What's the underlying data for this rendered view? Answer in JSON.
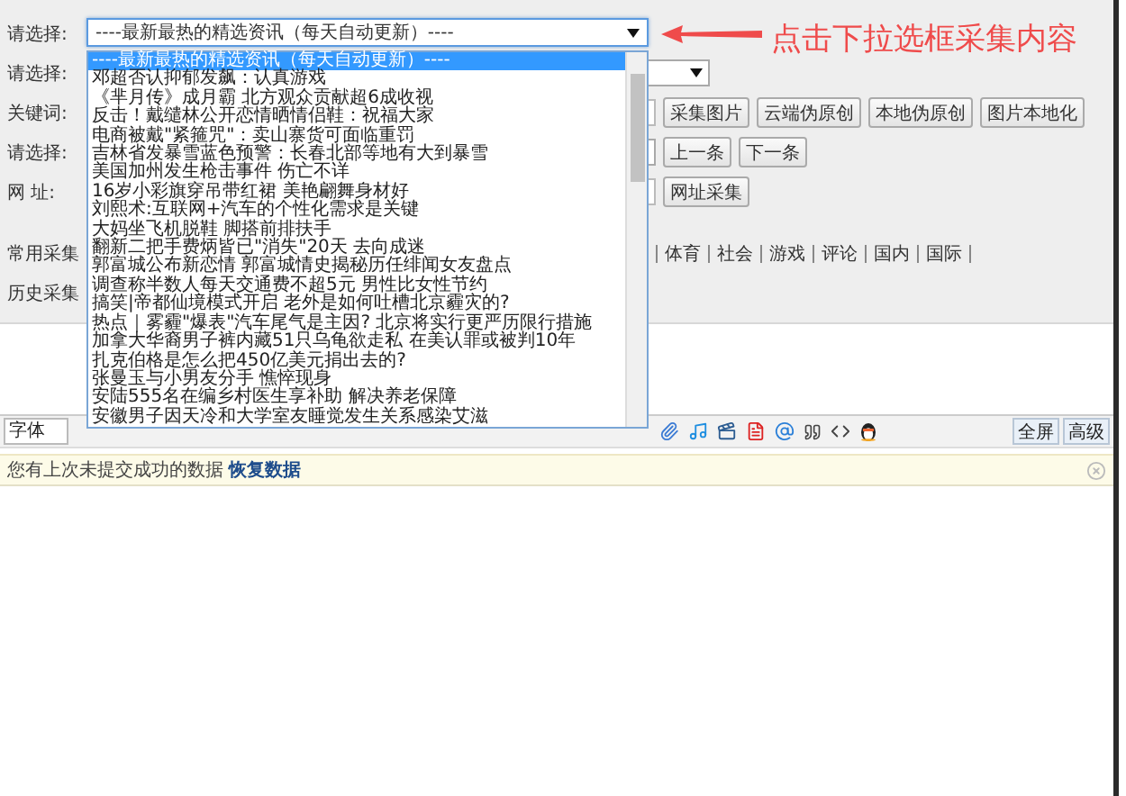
{
  "dropdown": {
    "value": "----最新最热的精选资讯（每天自动更新）----",
    "expanded": true,
    "options": [
      {
        "text": "----最新最热的精选资讯（每天自动更新）----",
        "selected": true
      },
      {
        "text": "邓超否认抑郁发飙：认真游戏",
        "selected": false
      },
      {
        "text": "《芈月传》成月霸 北方观众贡献超6成收视",
        "selected": false
      },
      {
        "text": "反击！戴缱林公开恋情晒情侣鞋：祝福大家",
        "selected": false
      },
      {
        "text": "电商被戴\"紧箍咒\"：卖山寨货可面临重罚",
        "selected": false
      },
      {
        "text": "吉林省发暴雪蓝色预警：长春北部等地有大到暴雪",
        "selected": false
      },
      {
        "text": "美国加州发生枪击事件 伤亡不详",
        "selected": false
      },
      {
        "text": "16岁小彩旗穿吊带红裙 美艳翩舞身材好",
        "selected": false
      },
      {
        "text": "刘熙术:互联网+汽车的个性化需求是关键",
        "selected": false
      },
      {
        "text": "大妈坐飞机脱鞋 脚搭前排扶手",
        "selected": false
      },
      {
        "text": "翻新二把手费炳皆已\"消失\"20天 去向成迷",
        "selected": false
      },
      {
        "text": "郭富城公布新恋情 郭富城情史揭秘历任绯闻女友盘点",
        "selected": false
      },
      {
        "text": "调查称半数人每天交通费不超5元 男性比女性节约",
        "selected": false
      },
      {
        "text": "搞笑|帝都仙境模式开启 老外是如何吐槽北京霾灾的?",
        "selected": false
      },
      {
        "text": "热点｜雾霾\"爆表\"汽车尾气是主因? 北京将实行更严历限行措施",
        "selected": false
      },
      {
        "text": "加拿大华裔男子裤内藏51只乌龟欲走私 在美认罪或被判10年",
        "selected": false
      },
      {
        "text": "扎克伯格是怎么把450亿美元捐出去的?",
        "selected": false
      },
      {
        "text": "张曼玉与小男友分手 憔悴现身",
        "selected": false
      },
      {
        "text": "安陆555名在编乡村医生享补助 解决养老保障",
        "selected": false
      },
      {
        "text": "安徽男子因天冷和大学室友睡觉发生关系感染艾滋",
        "selected": false
      }
    ]
  },
  "annotation": "点击下拉选框采集内容",
  "form_rows": [
    {
      "label": "请选择:",
      "kind": "dropdown"
    },
    {
      "label": "请选择:",
      "kind": "select"
    },
    {
      "label": "关键词:",
      "kind": "keyword",
      "buttons": [
        "采集图片",
        "云端伪原创",
        "本地伪原创",
        "图片本地化"
      ]
    },
    {
      "label": "请选择:",
      "kind": "select_buttons",
      "buttons": [
        "上一条",
        "下一条"
      ]
    },
    {
      "label": "网 址:",
      "kind": "url",
      "buttons": [
        "网址采集"
      ]
    },
    {
      "label": "常用采集",
      "kind": "links",
      "links": [
        "体育",
        "社会",
        "游戏",
        "评论",
        "国内",
        "国际"
      ]
    },
    {
      "label": "历史采集",
      "kind": "empty"
    }
  ],
  "toolbar": {
    "font_field": "字体",
    "buttons": [
      "全屏",
      "高级"
    ]
  },
  "notice": {
    "text": "您有上次未提交成功的数据 **恢复数据**"
  }
}
